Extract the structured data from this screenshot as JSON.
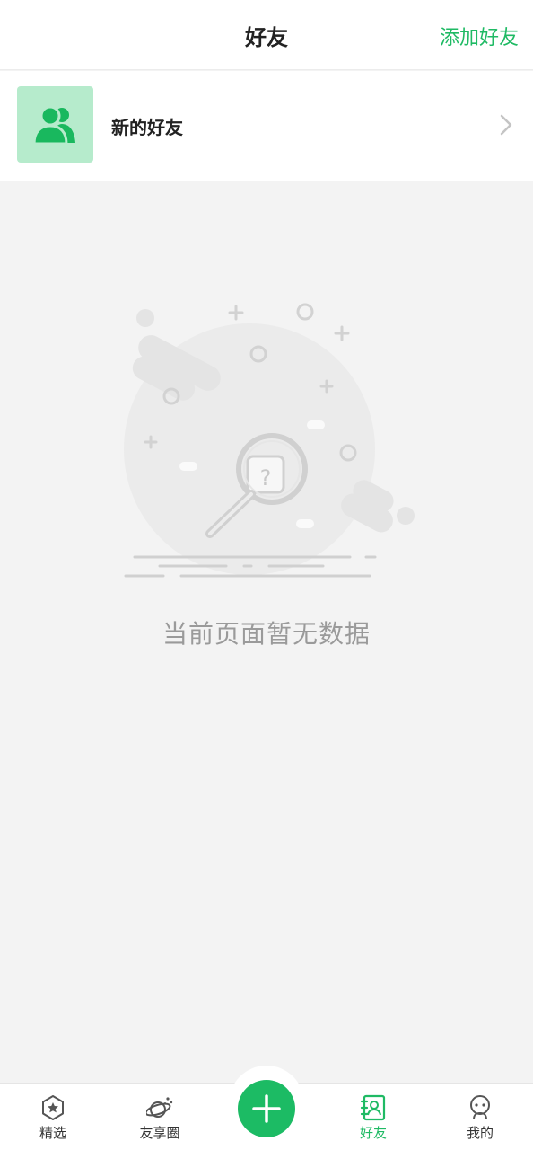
{
  "header": {
    "title": "好友",
    "action_label": "添加好友"
  },
  "new_friends": {
    "label": "新的好友",
    "icon": "people-icon"
  },
  "empty_state": {
    "message": "当前页面暂无数据",
    "icon": "magnifier-question-icon"
  },
  "tabbar": {
    "tabs": [
      {
        "label": "精选",
        "icon": "star-hexagon-icon",
        "active": false
      },
      {
        "label": "友享圈",
        "icon": "planet-icon",
        "active": false
      },
      {
        "label": "好友",
        "icon": "contact-book-icon",
        "active": true
      },
      {
        "label": "我的",
        "icon": "robot-face-icon",
        "active": false
      }
    ],
    "center_button_icon": "plus-icon"
  },
  "colors": {
    "accent": "#1fba64",
    "icon_bg": "#b6ebcc",
    "page_bg": "#f3f3f3",
    "empty_text": "#9a9a9a"
  }
}
